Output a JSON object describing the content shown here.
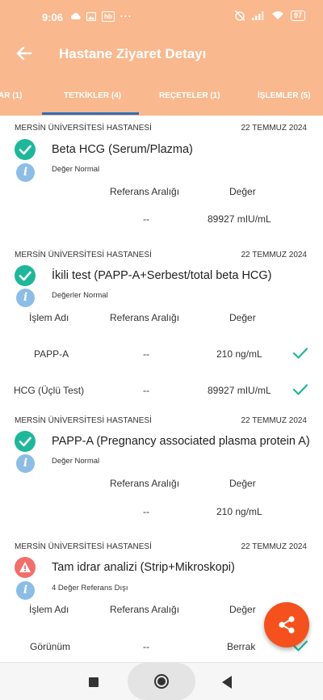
{
  "status_bar": {
    "time": "9:06",
    "battery": "97",
    "dots": "···",
    "app_badge": "hb"
  },
  "app_bar": {
    "title": "Hastane Ziyaret Detayı"
  },
  "tabs": [
    {
      "label": "AR (1)"
    },
    {
      "label": "TETKİKLER (4)"
    },
    {
      "label": "REÇETELER (1)"
    },
    {
      "label": "İŞLEMLER (5)"
    }
  ],
  "colors": {
    "header": "#f9b88e",
    "ok": "#1fb79a",
    "warn": "#f16f6a",
    "info": "#8bbde6",
    "fab": "#f4511e",
    "tab_indicator": "#2b6fbd"
  },
  "tests": [
    {
      "hospital": "MERSİN ÜNİVERSİTESİ HASTANESİ",
      "date": "22 TEMMUZ 2024",
      "status_icon": "check-circle-icon",
      "name": "Beta HCG (Serum/Plazma)",
      "note": "Değer Normal",
      "col_ref": "Referans Aralığı",
      "col_value": "Değer",
      "rows": [
        {
          "ref": "--",
          "value": "89927 mIU/mL"
        }
      ]
    },
    {
      "hospital": "MERSİN ÜNİVERSİTESİ HASTANESİ",
      "date": "22 TEMMUZ 2024",
      "status_icon": "check-circle-icon",
      "name": "İkili test (PAPP-A+Serbest/total beta HCG)",
      "note": "Değerler Normal",
      "col_name": "İşlem Adı",
      "col_ref": "Referans Aralığı",
      "col_value": "Değer",
      "rows": [
        {
          "name": "PAPP-A",
          "ref": "--",
          "value": "210 ng/mL"
        },
        {
          "name": "HCG (Üçlü Test)",
          "ref": "--",
          "value": "89927 mIU/mL"
        }
      ]
    },
    {
      "hospital": "MERSİN ÜNİVERSİTESİ HASTANESİ",
      "date": "22 TEMMUZ 2024",
      "status_icon": "check-circle-icon",
      "name": "PAPP-A (Pregnancy associated plasma protein A)",
      "note": "Değer Normal",
      "col_ref": "Referans Aralığı",
      "col_value": "Değer",
      "rows": [
        {
          "ref": "--",
          "value": "210 ng/mL"
        }
      ]
    },
    {
      "hospital": "MERSİN ÜNİVERSİTESİ HASTANESİ",
      "date": "22 TEMMUZ 2024",
      "status_icon": "warning-icon",
      "name": "Tam idrar analizi (Strip+Mikroskopi)",
      "note": "4 Değer Referans Dışı",
      "col_name": "İşlem Adı",
      "col_ref": "Referans Aralığı",
      "col_value": "Değer",
      "rows": [
        {
          "name": "Görünüm",
          "ref": "--",
          "value": "Berrak"
        }
      ]
    }
  ],
  "fab": {
    "icon": "share-icon"
  }
}
